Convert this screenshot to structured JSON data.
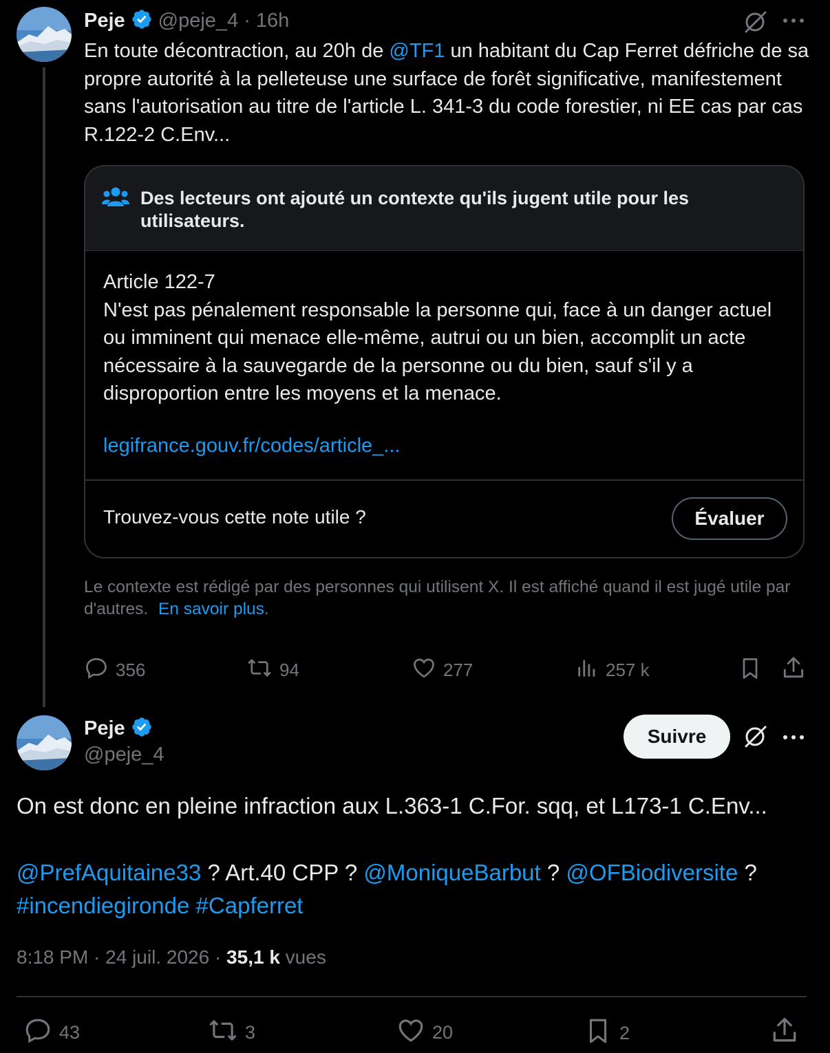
{
  "colors": {
    "background": "#000000",
    "text": "#e7e9ea",
    "muted": "#71767b",
    "link": "#1d9bf0",
    "verified": "#1d9bf0",
    "border": "#2f3336"
  },
  "tweet1": {
    "author_name": "Peje",
    "handle": "@peje_4",
    "time": "· 16h",
    "text_before": "En toute décontraction, au 20h de ",
    "mention": "@TF1",
    "text_after": "  un habitant du Cap Ferret défriche de sa propre autorité à la pelleteuse une surface de forêt significative, manifestement sans l'autorisation au titre de l'article L. 341-3 du code forestier, ni EE cas par cas R.122-2 C.Env...",
    "note": {
      "header": "Des lecteurs ont ajouté un contexte qu'ils jugent utile pour les utilisateurs.",
      "title": "Article 122-7",
      "body": "N'est pas pénalement responsable la personne qui, face à un danger actuel ou imminent qui menace elle-même, autrui ou un bien, accomplit un acte nécessaire à la sauvegarde de la personne ou du bien, sauf s'il y a disproportion entre les moyens et la menace.",
      "link": "legifrance.gouv.fr/codes/article_...",
      "question": "Trouvez-vous cette note utile ?",
      "rate_label": "Évaluer"
    },
    "disclaimer": "Le contexte est rédigé par des personnes qui utilisent X. Il est affiché quand il est jugé utile par d'autres.",
    "learn_more": "En savoir plus",
    "learn_more_suffix": ".",
    "replies": "356",
    "reposts": "94",
    "likes": "277",
    "views": "257 k"
  },
  "tweet2": {
    "author_name": "Peje",
    "handle": "@peje_4",
    "follow_label": "Suivre",
    "line1": "On est donc en pleine infraction aux L.363-1 C.For. sqq, et L173-1 C.Env...",
    "mention1": "@PrefAquitaine33",
    "sep1": " ? Art.40 CPP ? ",
    "mention2": "@MoniqueBarbut",
    "sep2": " ? ",
    "mention3": "@OFBiodiversite",
    "sep3": " ?",
    "hashtag1": "#incendiegironde",
    "hashtag2": "#Capferret",
    "timestamp": "8:18 PM · 24 juil. 2026 · ",
    "views_count": "35,1 k",
    "views_label": " vues",
    "replies": "43",
    "reposts": "3",
    "likes": "20",
    "bookmarks": "2"
  },
  "icons": [
    "verified-icon",
    "grok-icon",
    "more-icon",
    "community-icon",
    "reply-icon",
    "repost-icon",
    "like-icon",
    "views-icon",
    "bookmark-icon",
    "share-icon"
  ]
}
